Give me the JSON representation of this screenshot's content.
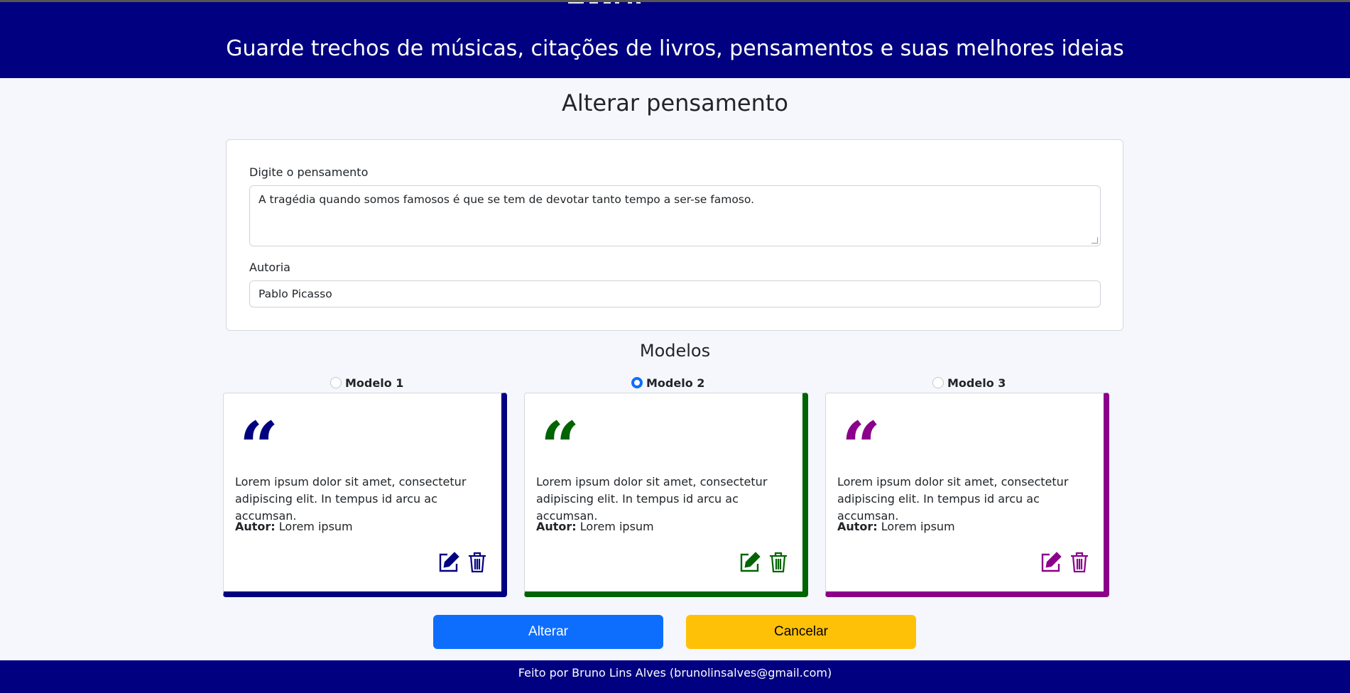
{
  "header": {
    "tagline": "Guarde trechos de músicas, citações de livros, pensamentos e suas melhores ideias"
  },
  "page": {
    "title": "Alterar pensamento"
  },
  "form": {
    "thought_label": "Digite o pensamento",
    "thought_value": "A tragédia quando somos famosos é que se tem de devotar tanto tempo a ser-se famoso.",
    "author_label": "Autoria",
    "author_value": "Pablo Picasso"
  },
  "models": {
    "title": "Modelos",
    "selected": "Modelo 2",
    "items": [
      {
        "label": "Modelo 1",
        "color": "#000080",
        "checked": false,
        "quote_icon": "quote-icon",
        "text": "Lorem ipsum dolor sit amet, consectetur adipiscing elit. In tempus id arcu ac accumsan.",
        "author_prefix": "Autor:",
        "author": "Lorem ipsum"
      },
      {
        "label": "Modelo 2",
        "color": "#006400",
        "checked": true,
        "quote_icon": "quote-icon",
        "text": "Lorem ipsum dolor sit amet, consectetur adipiscing elit. In tempus id arcu ac accumsan.",
        "author_prefix": "Autor:",
        "author": "Lorem ipsum"
      },
      {
        "label": "Modelo 3",
        "color": "#8b008b",
        "checked": false,
        "quote_icon": "quote-icon",
        "text": "Lorem ipsum dolor sit amet, consectetur adipiscing elit. In tempus id arcu ac accumsan.",
        "author_prefix": "Autor:",
        "author": "Lorem ipsum"
      }
    ]
  },
  "actions": {
    "submit_label": "Alterar",
    "cancel_label": "Cancelar"
  },
  "footer": {
    "text": "Feito por Bruno Lins Alves (brunolinsalves@gmail.com)"
  },
  "colors": {
    "header_bg": "#000080",
    "primary": "#0d6efd",
    "warning": "#ffc107",
    "page_bg": "#f5f7fc"
  }
}
